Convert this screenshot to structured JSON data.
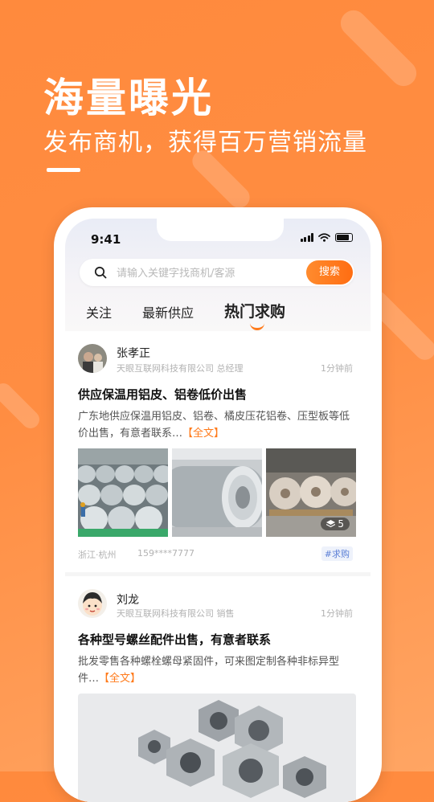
{
  "hero": {
    "title": "海量曝光",
    "subtitle": "发布商机，获得百万营销流量"
  },
  "status_bar": {
    "time": "9:41",
    "icons": [
      "signal-icon",
      "wifi-icon",
      "battery-icon"
    ]
  },
  "search": {
    "placeholder": "请输入关键字找商机/客源",
    "button_label": "搜索"
  },
  "tabs": [
    {
      "label": "关注"
    },
    {
      "label": "最新供应"
    },
    {
      "label": "热门求购",
      "active": true
    }
  ],
  "posts": [
    {
      "name": "张孝正",
      "company": "天眼互联网科技有限公司 总经理",
      "time": "1分钟前",
      "title": "供应保温用铝皮、铝卷低价出售",
      "desc": "广东地供应保温用铝皮、铝卷、橘皮压花铝卷、压型板等低价出售，有意者联系…",
      "more": "【全文】",
      "image_count": "5",
      "location": "浙江·杭州",
      "phone": "159****7777",
      "tag": "#求购"
    },
    {
      "name": "刘龙",
      "company": "天眼互联网科技有限公司 销售",
      "time": "1分钟前",
      "title": "各种型号螺丝配件出售，有意者联系",
      "desc": "批发零售各种螺栓螺母紧固件，可来图定制各种非标异型件…",
      "more": "【全文】"
    }
  ],
  "colors": {
    "brand_orange": "#ff7a1a",
    "background_orange": "#ff8a3d",
    "tag_blue": "#5b7fd6"
  }
}
